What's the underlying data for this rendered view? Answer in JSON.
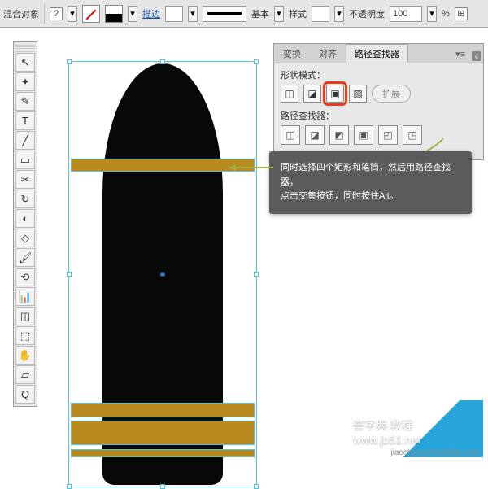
{
  "toolbar": {
    "blend_label": "混合对象",
    "stroke_link": "描边",
    "stroke_weight": "",
    "stroke_style_label": "基本",
    "style_label": "样式",
    "opacity_label": "不透明度",
    "opacity_value": "100",
    "opacity_unit": "%"
  },
  "tools": [
    "↖",
    "✦",
    "✎",
    "T",
    "╱",
    "▭",
    "✂",
    "↻",
    "◐",
    "◇",
    "🖌",
    "⟲",
    "📊",
    "◫",
    "⬚",
    "✋",
    "▱",
    "Q"
  ],
  "panel": {
    "tabs": [
      "变换",
      "对齐",
      "路径查找器"
    ],
    "active_tab": 2,
    "shape_mode_label": "形状模式：",
    "expand_label": "扩展",
    "pathfinder_label": "路径查找器："
  },
  "tooltip": {
    "line1": "同时选择四个矩形和笔筒，然后用路径查找器，",
    "line2": "点击交集按钮，同时按住Alt。"
  },
  "watermark": {
    "main": "查字典 教程www.jb51.net",
    "sub": "jiaocheng.chazidian.com"
  }
}
